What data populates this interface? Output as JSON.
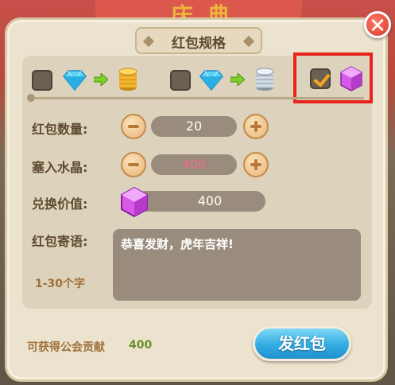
{
  "background": {
    "banner_text": "庆典"
  },
  "dialog": {
    "title": "红包规格",
    "close_symbol": "✕"
  },
  "options": [
    {
      "checked": false,
      "from_icon": "blue-diamond-icon",
      "to_icon": "gold-coin-stack-icon"
    },
    {
      "checked": false,
      "from_icon": "blue-diamond-icon",
      "to_icon": "silver-coin-stack-icon"
    },
    {
      "checked": true,
      "icon": "purple-crystal-icon"
    }
  ],
  "form": {
    "count_label": "红包数量:",
    "count_value": "20",
    "crystal_label": "塞入水晶:",
    "crystal_value": "400",
    "exchange_label": "兑换价值:",
    "exchange_value": "400",
    "message_label": "红包寄语:",
    "message_value": "恭喜发财，虎年吉祥!",
    "message_hint": "1-30个字"
  },
  "footer": {
    "contribution_label": "可获得公会贡献",
    "contribution_value": "400",
    "send_label": "发红包"
  },
  "colors": {
    "highlight_border": "#e8231d",
    "send_button": "#38b0e4",
    "close_button": "#d8382a"
  }
}
